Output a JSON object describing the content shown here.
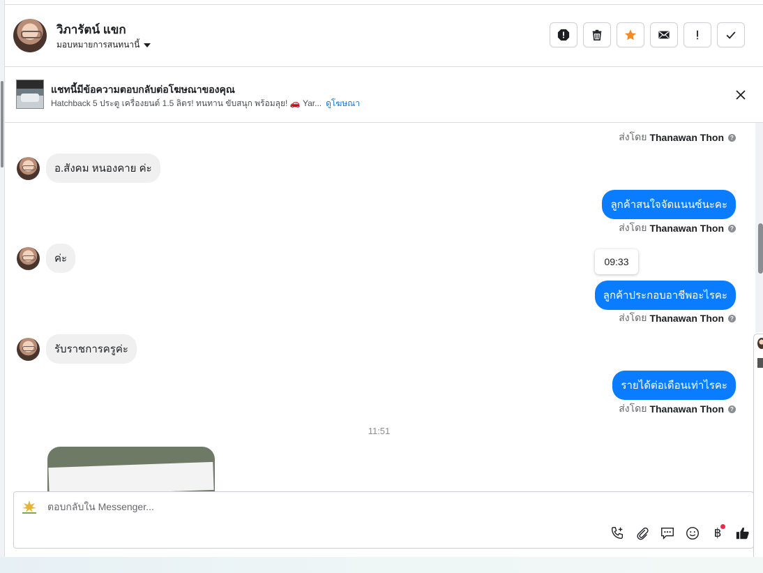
{
  "header": {
    "contact_name": "วิภารัตน์ แขก",
    "assign_label": "มอบหมายการสนทนานี้",
    "actions": [
      {
        "name": "spam-button",
        "icon": "alert-octagon-icon"
      },
      {
        "name": "delete-button",
        "icon": "trash-icon"
      },
      {
        "name": "star-button",
        "icon": "star-icon"
      },
      {
        "name": "mark-unread-button",
        "icon": "envelope-icon"
      },
      {
        "name": "follow-up-button",
        "icon": "exclamation-icon"
      },
      {
        "name": "done-button",
        "icon": "checkmark-icon"
      }
    ]
  },
  "ad": {
    "title": "แชทนี้มีข้อความตอบกลับต่อโฆษณาของคุณ",
    "description": "Hatchback 5 ประตู เครื่องยนต์ 1.5 ลิตร! ทนทาน ขับสนุก พร้อมลุย! 🚗 Yar...",
    "link_label": "ดูโฆษณา"
  },
  "messages": {
    "sent_by_prefix": "ส่งโดย",
    "sender_name": "Thanawan Thon",
    "incoming_1": "อ.สังคม หนองคาย ค่ะ",
    "outgoing_1": "ลูกค้าสนใจจัดแนนซ์นะคะ",
    "incoming_2": "ค่ะ",
    "tooltip_time": "09:33",
    "outgoing_2": "ลูกค้าประกอบอาชีพอะไรคะ",
    "incoming_3": "รับราชการครูค่ะ",
    "outgoing_3": "รายได้ต่อเดือนเท่าไรคะ",
    "time_separator": "11:51"
  },
  "composer": {
    "placeholder": "ตอบกลับใน Messenger...",
    "actions": [
      "phone-add-icon",
      "paperclip-icon",
      "saved-replies-icon",
      "emoji-icon",
      "baht-icon",
      "thumbs-up-icon"
    ],
    "baht_symbol": "฿"
  },
  "colors": {
    "outgoing_bubble": "#0a7cff",
    "incoming_bubble": "#f0f0f0",
    "star": "#f28b24",
    "link": "#1876d2"
  }
}
